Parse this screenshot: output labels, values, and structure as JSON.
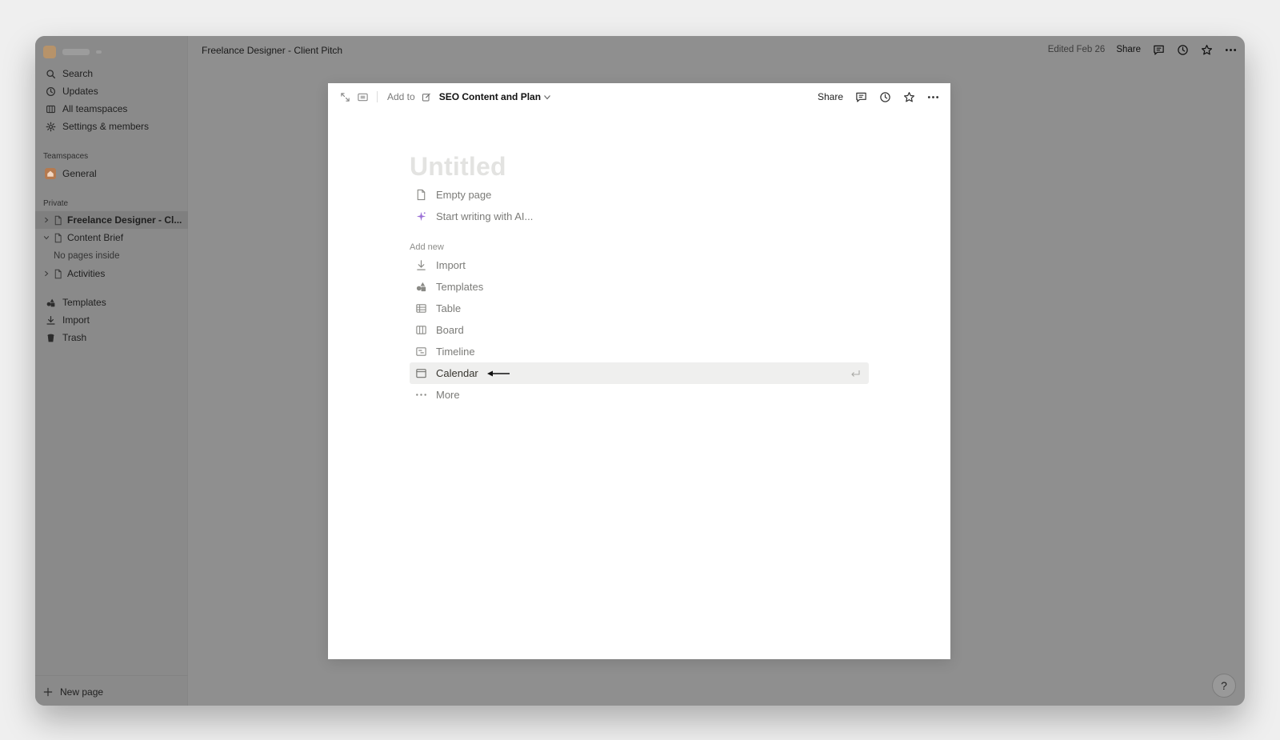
{
  "topbar": {
    "title": "Freelance Designer - Client Pitch",
    "edited": "Edited Feb 26",
    "share_label": "Share"
  },
  "sidebar": {
    "nav": [
      {
        "label": "Search",
        "icon": "search-icon"
      },
      {
        "label": "Updates",
        "icon": "clock-icon"
      },
      {
        "label": "All teamspaces",
        "icon": "teamspaces-icon"
      },
      {
        "label": "Settings & members",
        "icon": "gear-icon"
      }
    ],
    "teamspaces_heading": "Teamspaces",
    "teamspace_general": "General",
    "private_heading": "Private",
    "pages": [
      {
        "label": "Freelance Designer - Cl...",
        "expanded": false,
        "active": true
      },
      {
        "label": "Content Brief",
        "expanded": true,
        "active": false
      },
      {
        "label": "Activities",
        "expanded": false,
        "active": false
      }
    ],
    "no_pages_inside": "No pages inside",
    "tools": [
      {
        "label": "Templates",
        "icon": "templates-icon"
      },
      {
        "label": "Import",
        "icon": "import-icon"
      },
      {
        "label": "Trash",
        "icon": "trash-icon"
      }
    ],
    "new_page": "New page"
  },
  "modal": {
    "add_to_label": "Add to",
    "target_page": "SEO Content and Plan",
    "share_label": "Share",
    "title_placeholder": "Untitled",
    "quick_options": [
      {
        "label": "Empty page",
        "icon": "page-icon"
      },
      {
        "label": "Start writing with AI...",
        "icon": "ai-sparkle-icon"
      }
    ],
    "add_new_heading": "Add new",
    "add_new_items": [
      {
        "label": "Import",
        "icon": "import-icon"
      },
      {
        "label": "Templates",
        "icon": "templates-icon"
      },
      {
        "label": "Table",
        "icon": "table-icon"
      },
      {
        "label": "Board",
        "icon": "board-icon"
      },
      {
        "label": "Timeline",
        "icon": "timeline-icon"
      },
      {
        "label": "Calendar",
        "icon": "calendar-icon",
        "highlighted": true
      },
      {
        "label": "More",
        "icon": "more-dots-icon"
      }
    ]
  },
  "help_label": "?",
  "colors": {
    "backdrop": "#8f8f8f",
    "modal_bg": "#ffffff",
    "highlight_row": "#efefee",
    "placeholder": "#e3e3e1"
  }
}
